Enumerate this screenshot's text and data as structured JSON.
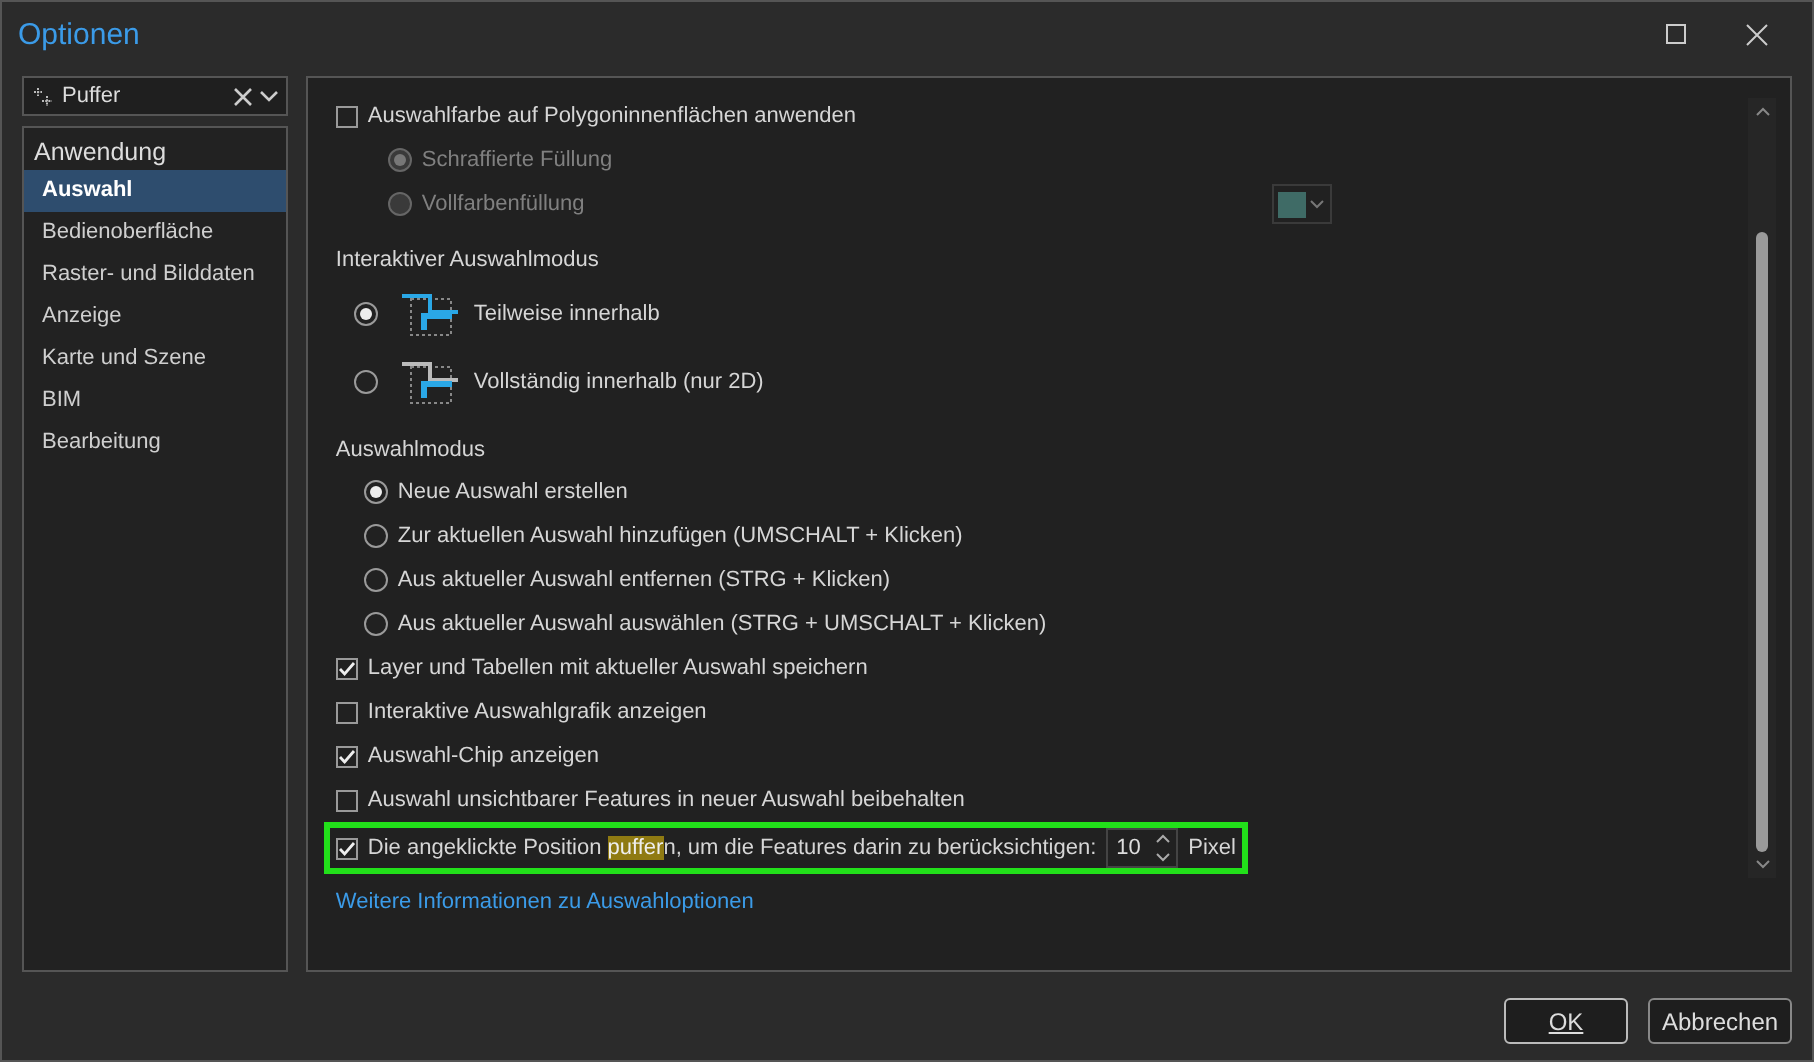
{
  "window": {
    "title": "Optionen"
  },
  "search": {
    "value": "Puffer"
  },
  "sidebar": {
    "heading": "Anwendung",
    "items": [
      {
        "label": "Auswahl",
        "selected": true
      },
      {
        "label": "Bedienoberfläche",
        "selected": false
      },
      {
        "label": "Raster- und Bilddaten",
        "selected": false
      },
      {
        "label": "Anzeige",
        "selected": false
      },
      {
        "label": "Karte und Szene",
        "selected": false
      },
      {
        "label": "BIM",
        "selected": false
      },
      {
        "label": "Bearbeitung",
        "selected": false
      }
    ]
  },
  "content": [
    {
      "kind": "checkbox",
      "label": "Auswahlfarbe auf Polygoninnenflächen anwenden",
      "checked": false,
      "children": [
        {
          "kind": "radio",
          "label": "Schraffierte Füllung",
          "selected": true,
          "disabled": true
        },
        {
          "kind": "radio",
          "label": "Vollfarbenfüllung",
          "selected": false,
          "disabled": true,
          "swatch": {
            "color": "#3f6b66"
          }
        }
      ]
    },
    {
      "kind": "heading",
      "label": "Interaktiver Auswahlmodus"
    },
    {
      "kind": "icon-radio",
      "label": "Teilweise innerhalb",
      "selected": true
    },
    {
      "kind": "icon-radio",
      "label": "Vollständig innerhalb (nur 2D)",
      "selected": false
    },
    {
      "kind": "heading",
      "label": "Auswahlmodus"
    },
    {
      "kind": "radio",
      "label": "Neue Auswahl erstellen",
      "selected": true,
      "disabled": false
    },
    {
      "kind": "radio",
      "label": "Zur aktuellen Auswahl hinzufügen (UMSCHALT + Klicken)",
      "selected": false,
      "disabled": false
    },
    {
      "kind": "radio",
      "label": "Aus aktueller Auswahl entfernen (STRG + Klicken)",
      "selected": false,
      "disabled": false
    },
    {
      "kind": "radio",
      "label": "Aus aktueller Auswahl auswählen (STRG + UMSCHALT + Klicken)",
      "selected": false,
      "disabled": false
    },
    {
      "kind": "checkbox",
      "label": "Layer und Tabellen mit aktueller Auswahl speichern",
      "checked": true
    },
    {
      "kind": "checkbox",
      "label": "Interaktive Auswahlgrafik anzeigen",
      "checked": false
    },
    {
      "kind": "checkbox",
      "label": "Auswahl-Chip anzeigen",
      "checked": true
    },
    {
      "kind": "checkbox",
      "label": "Auswahl unsichtbarer Features in neuer Auswahl beibehalten",
      "checked": false
    },
    {
      "kind": "buffer",
      "checked": true,
      "outlined": true,
      "parts": [
        {
          "text": "Die angeklickte Position ",
          "highlighted": false
        },
        {
          "text": "puffer",
          "highlighted": true
        },
        {
          "text": "n, um die Features darin zu berücksichtigen:",
          "highlighted": false
        }
      ],
      "value": "10",
      "unit": "Pixel"
    },
    {
      "kind": "link",
      "label": "Weitere Informationen zu Auswahloptionen"
    }
  ],
  "buttons": [
    {
      "label": "OK",
      "default": true
    },
    {
      "label": "Abbrechen",
      "default": false
    }
  ]
}
